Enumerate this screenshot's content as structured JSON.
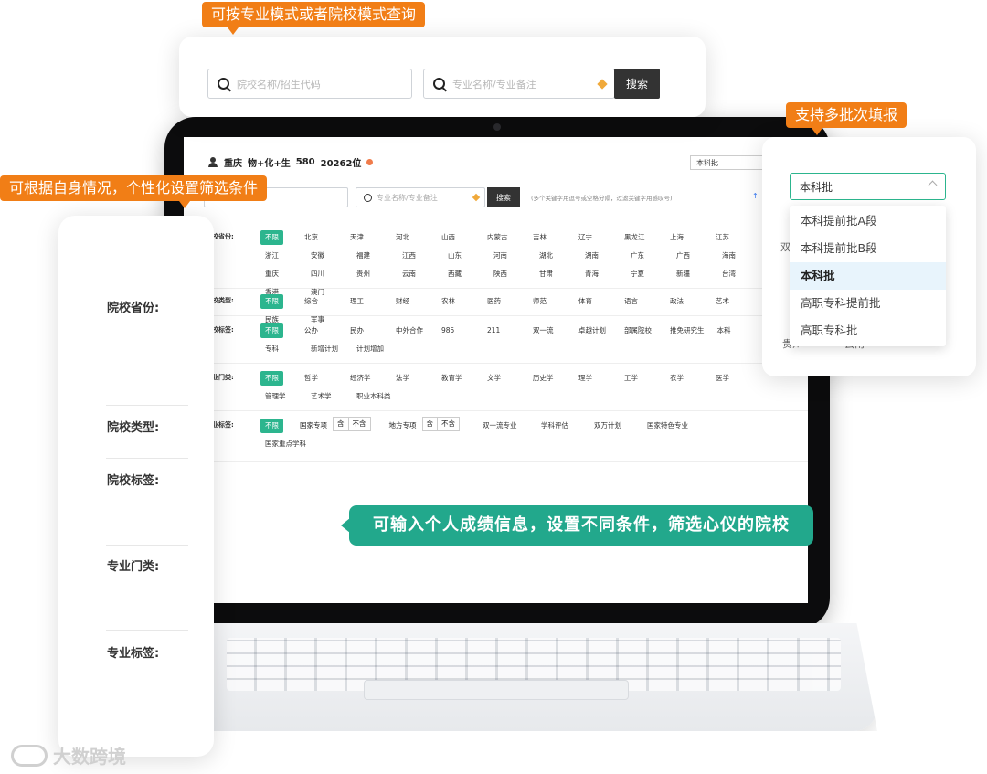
{
  "callouts": {
    "top": "可按专业模式或者院校模式查询",
    "left": "可根据自身情况，个性化设置筛选条件",
    "right": "支持多批次填报",
    "center": "可输入个人成绩信息，设置不同条件，筛选心仪的院校"
  },
  "search_card": {
    "school_placeholder": "院校名称/招生代码",
    "major_placeholder": "专业名称/专业备注",
    "search_label": "搜索"
  },
  "screen": {
    "province": "重庆",
    "subjects": "物+化+生",
    "score": "580",
    "rank": "20262位",
    "batch_value": "本科批",
    "major_placeholder": "专业名称/专业备注",
    "search_label": "搜索",
    "hint": "(多个关键字用逗号或空格分隔，过滤关键字用感叹号)",
    "upload": "↑",
    "rows": [
      {
        "label": "院校省份:",
        "chips": [
          "不限",
          "北京",
          "天津",
          "河北",
          "山西",
          "内蒙古",
          "吉林",
          "辽宁",
          "黑龙江",
          "上海",
          "江苏",
          "浙江",
          "安徽",
          "福建",
          "江西",
          "山东",
          "河南",
          "湖北",
          "湖南",
          "广东",
          "广西",
          "海南",
          "重庆",
          "四川",
          "贵州",
          "云南",
          "西藏",
          "陕西",
          "甘肃",
          "青海",
          "宁夏",
          "新疆",
          "台湾",
          "香港",
          "澳门"
        ]
      },
      {
        "label": "院校类型:",
        "chips": [
          "不限",
          "综合",
          "理工",
          "财经",
          "农林",
          "医药",
          "师范",
          "体育",
          "语言",
          "政法",
          "艺术",
          "民族",
          "军事"
        ]
      },
      {
        "label": "院校标签:",
        "chips": [
          "不限",
          "公办",
          "民办",
          "中外合作",
          "985",
          "211",
          "双一流",
          "卓越计划",
          "部属院校",
          "推免研究生",
          "本科",
          "专科",
          "新增计划",
          "计划增加"
        ]
      },
      {
        "label": "专业门类:",
        "chips": [
          "不限",
          "哲学",
          "经济学",
          "法学",
          "教育学",
          "文学",
          "历史学",
          "理学",
          "工学",
          "农学",
          "医学",
          "管理学",
          "艺术学",
          "职业本科类"
        ]
      }
    ],
    "tag_row": {
      "label": "专业标签:",
      "all": "不限",
      "national": "国家专项",
      "local": "地方专项",
      "include": "含",
      "exclude": "不含",
      "others": [
        "双一流专业",
        "学科评估",
        "双万计划",
        "国家特色专业"
      ],
      "last": "国家重点学科"
    }
  },
  "filter_card": {
    "labels": [
      "院校省份:",
      "院校类型:",
      "院校标签:",
      "专业门类:",
      "专业标签:"
    ]
  },
  "batch_card": {
    "selected": "本科批",
    "options": [
      "本科提前批A段",
      "本科提前批B段",
      "本科批",
      "高职专科提前批",
      "高职专科批"
    ],
    "active_index": 2,
    "behind_left": "双",
    "behind_bottom_left": "贵州",
    "behind_bottom_right": "云南"
  },
  "watermark": "大数跨境",
  "colors": {
    "accent_green": "#2cb58e",
    "callout_orange": "#f17e16",
    "callout_green": "#22a88c"
  }
}
